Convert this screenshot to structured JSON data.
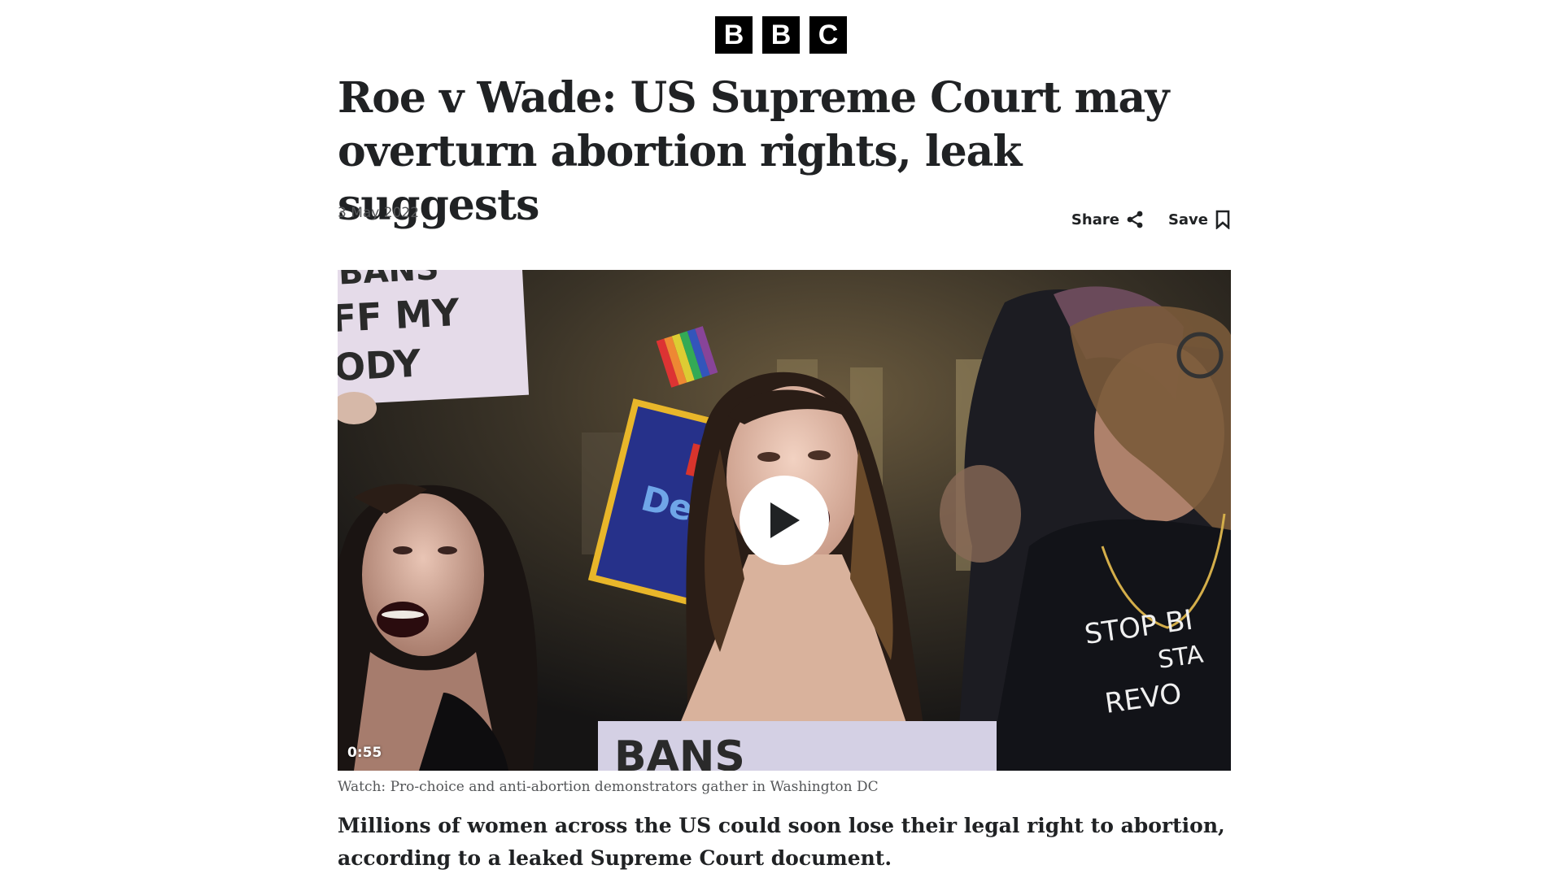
{
  "brand": {
    "logo_letters": [
      "B",
      "B",
      "C"
    ]
  },
  "article": {
    "headline": "Roe v Wade: US Supreme Court may overturn abortion rights, leak suggests",
    "date": "3 May 2022",
    "actions": {
      "share_label": "Share",
      "save_label": "Save"
    },
    "media": {
      "duration": "0:55",
      "play_icon": "play-icon",
      "caption": "Watch: Pro-choice and anti-abortion demonstrators gather in Washington DC",
      "sign_texts": [
        "BANS",
        "FF MY",
        "ODY",
        "STOP BI",
        "STA",
        "REVO",
        "BANS",
        "Li",
        "Den"
      ]
    },
    "lede": "Millions of women across the US could soon lose their legal right to abortion, according to a leaked Supreme Court document."
  },
  "colors": {
    "text_primary": "#202224",
    "text_secondary": "#545658",
    "logo_bg": "#000000",
    "play_bg": "#ffffff"
  },
  "icons": {
    "share": "share-icon",
    "save": "bookmark-icon"
  }
}
